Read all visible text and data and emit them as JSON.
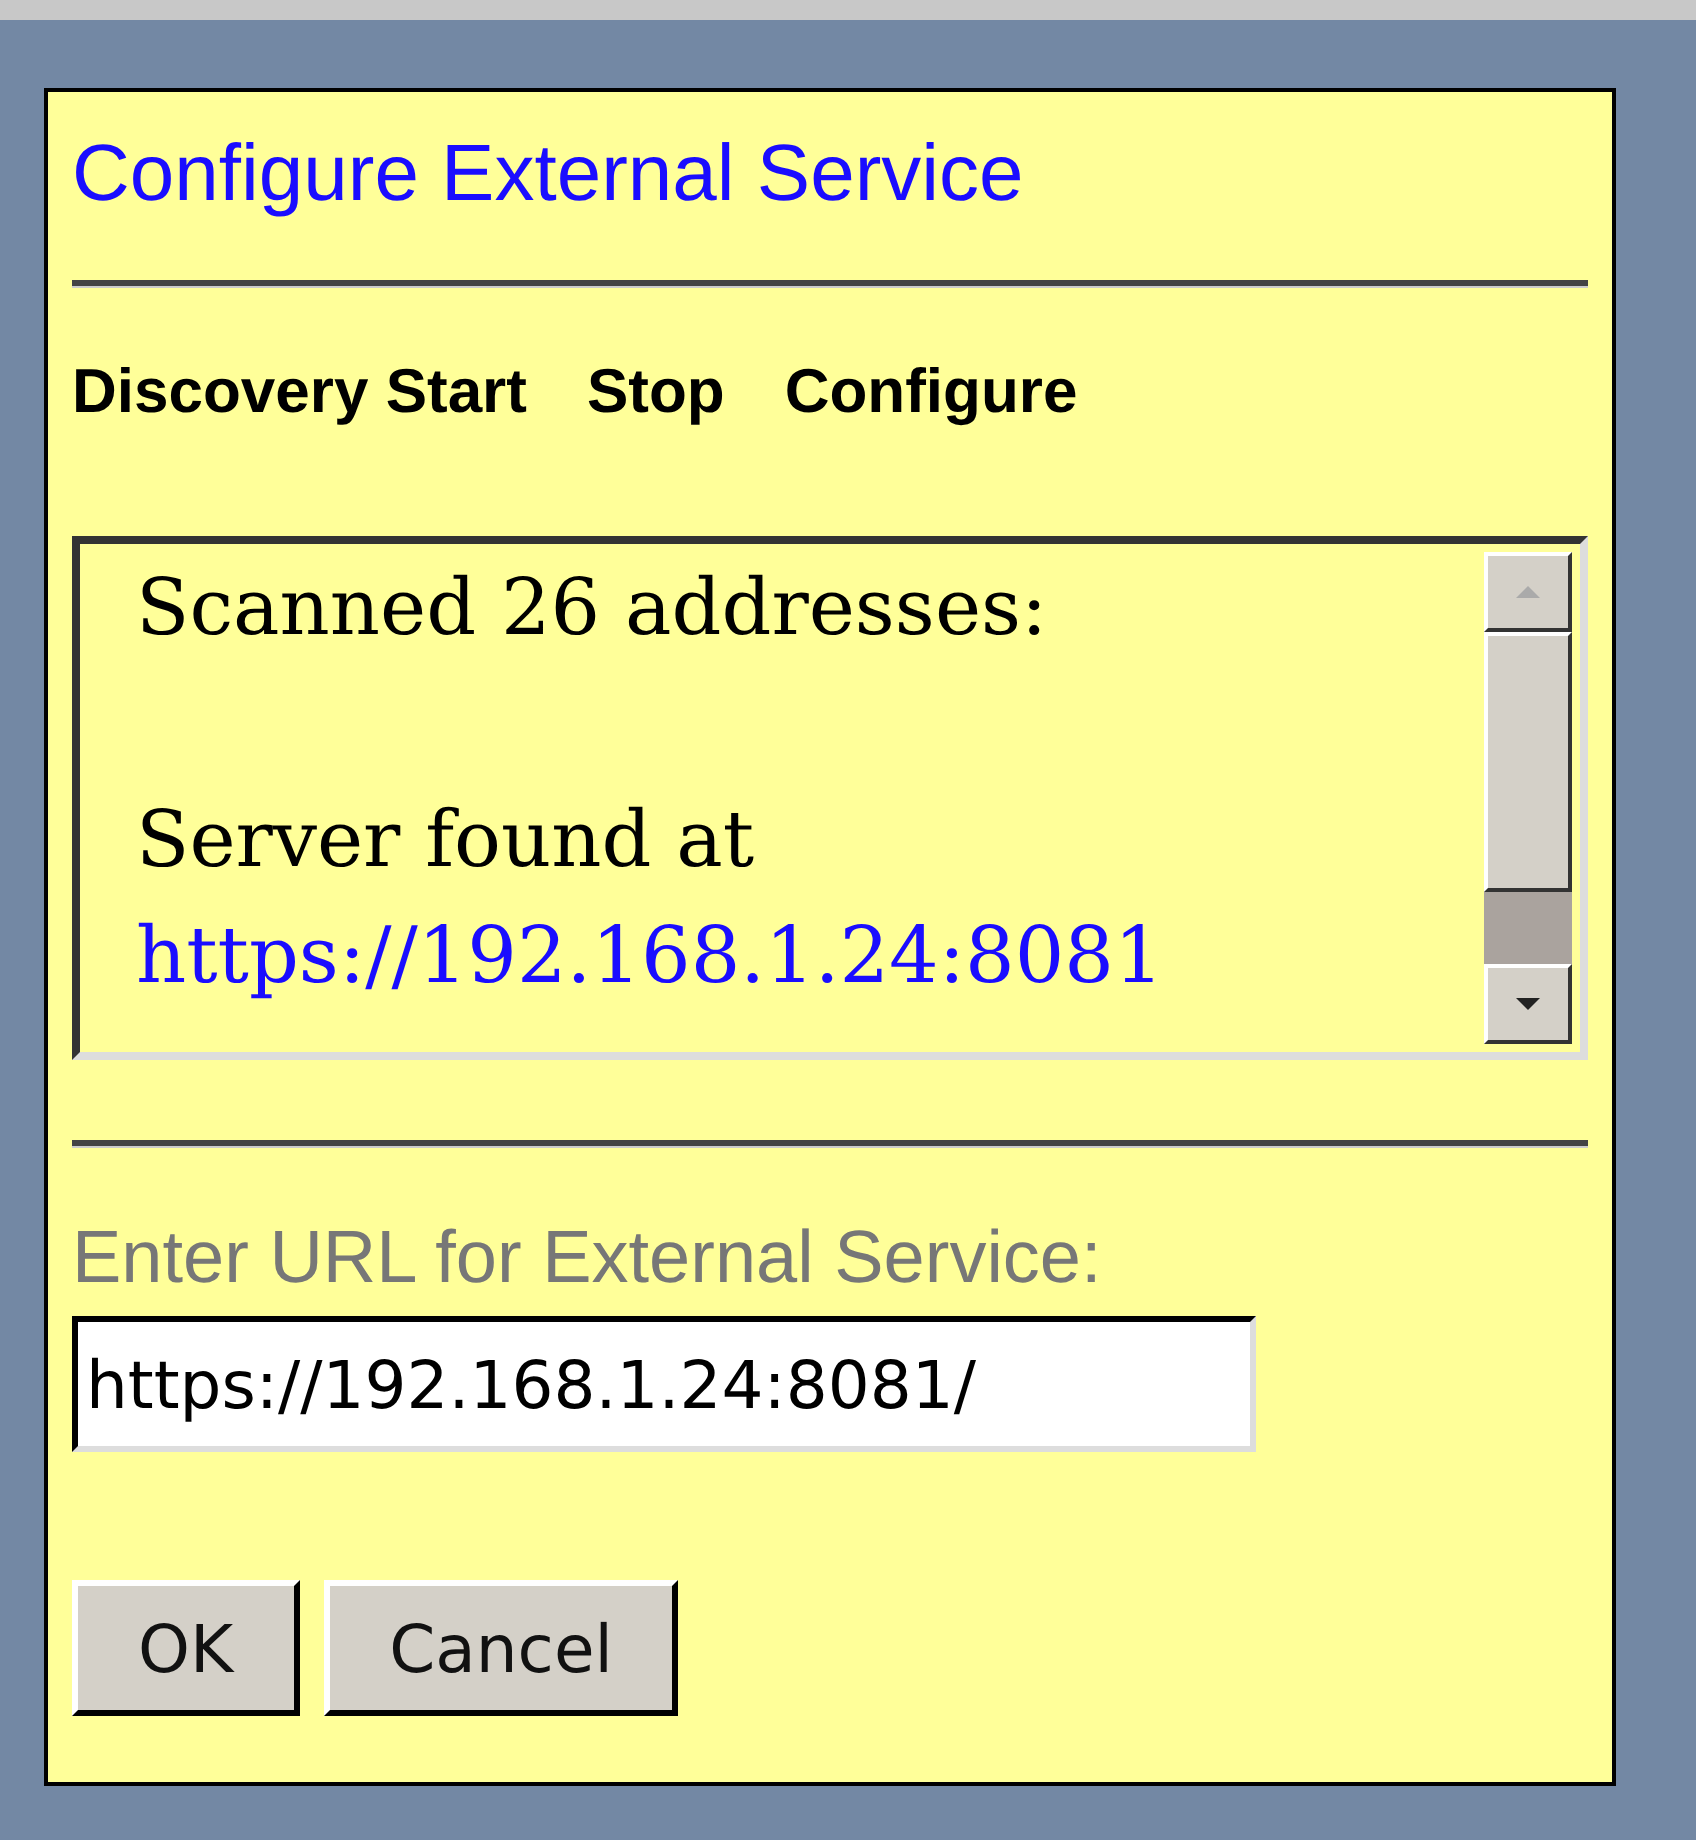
{
  "dialog": {
    "title": "Configure External Service",
    "toolbar": [
      {
        "label": "Discovery Start"
      },
      {
        "label": "Stop"
      },
      {
        "label": "Configure"
      }
    ],
    "log": {
      "lines": [
        {
          "kind": "text",
          "text": "Scanned 26 addresses:"
        },
        {
          "kind": "blank"
        },
        {
          "kind": "text",
          "text": "Server found at"
        },
        {
          "kind": "link",
          "text": "https://192.168.1.24:8081"
        }
      ]
    },
    "url_label": "Enter URL for External Service:",
    "url_field": {
      "value": "https://192.168.1.24:8081/"
    },
    "buttons": [
      "OK",
      "Cancel"
    ]
  }
}
